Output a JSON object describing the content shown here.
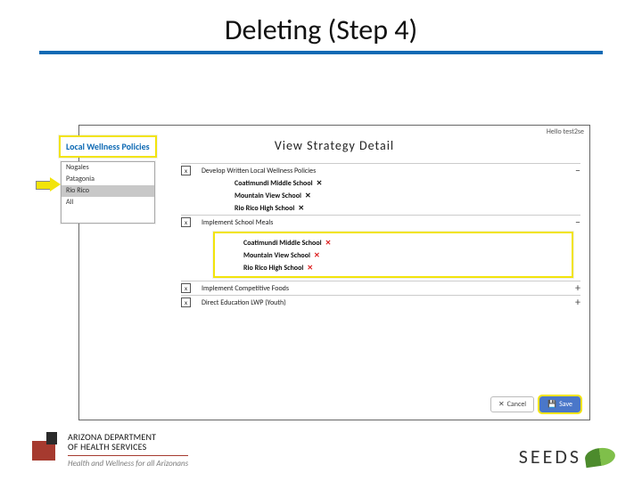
{
  "title": "Deleting (Step 4)",
  "app": {
    "user_label": "Hello test2se",
    "page_title": "View Strategy Detail",
    "sidebar": {
      "heading": "Local Wellness Policies",
      "options": [
        "Nogales",
        "Patagonia",
        "Rio Rico",
        "All"
      ],
      "selected_index": 2
    },
    "groups": [
      {
        "checked": true,
        "label": "Develop Written Local Wellness Policies",
        "toggle": "–",
        "subs": [
          {
            "label": "Coatimundi Middle School",
            "x_red": false
          },
          {
            "label": "Mountain View School",
            "x_red": false
          },
          {
            "label": "Rio Rico High School",
            "x_red": false
          }
        ]
      },
      {
        "checked": true,
        "label": "Implement School Meals",
        "toggle": "–",
        "highlight_subs": true,
        "subs": [
          {
            "label": "Coatimundi Middle School",
            "x_red": true
          },
          {
            "label": "Mountain View School",
            "x_red": true
          },
          {
            "label": "Rio Rico High School",
            "x_red": true
          }
        ]
      },
      {
        "checked": true,
        "label": "Implement Competitive Foods",
        "toggle": "+",
        "subs": []
      },
      {
        "checked": true,
        "label": "Direct Education LWP (Youth)",
        "toggle": "+",
        "subs": []
      }
    ],
    "buttons": {
      "cancel": "Cancel",
      "save": "Save"
    }
  },
  "footer": {
    "adhs_line1": "ARIZONA DEPARTMENT",
    "adhs_line2": "OF HEALTH SERVICES",
    "adhs_tag": "Health and Wellness for all Arizonans",
    "seeds": "SEEDS"
  }
}
